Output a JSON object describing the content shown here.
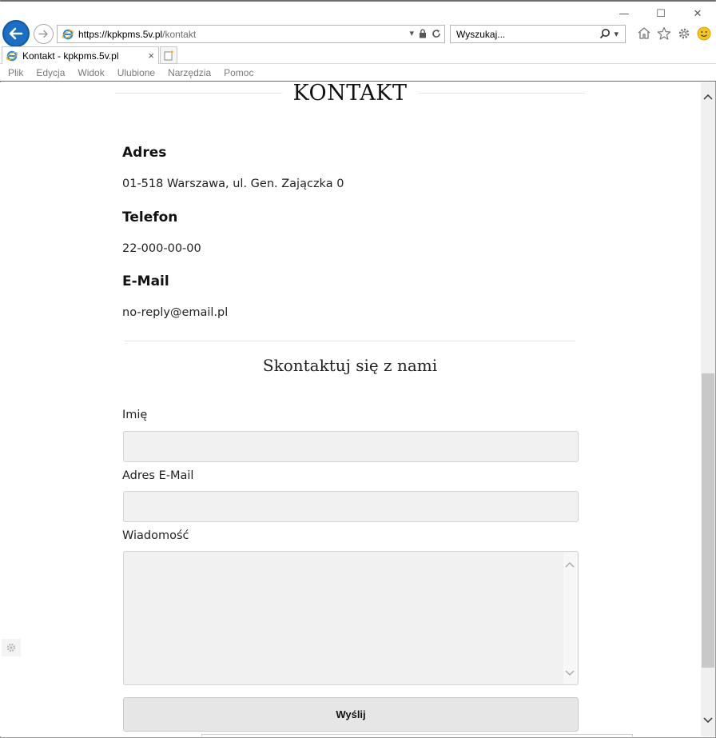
{
  "browser": {
    "window_controls": {
      "minimize": "—",
      "maximize": "☐",
      "close": "✕"
    },
    "address": {
      "host": "https://kpkpms.5v.pl",
      "path": "/kontakt"
    },
    "search": {
      "placeholder": "Wyszukaj..."
    },
    "tab": {
      "title": "Kontakt - kpkpms.5v.pl",
      "close": "×"
    },
    "menu": [
      "Plik",
      "Edycja",
      "Widok",
      "Ulubione",
      "Narzędzia",
      "Pomoc"
    ]
  },
  "page": {
    "title": "KONTAKT",
    "address": {
      "heading": "Adres",
      "value": "01-518 Warszawa, ul. Gen. Zajączka 0"
    },
    "phone": {
      "heading": "Telefon",
      "value": "22-000-00-00"
    },
    "email": {
      "heading": "E-Mail",
      "value": "no-reply@email.pl"
    },
    "form": {
      "title": "Skontaktuj się z nami",
      "name_label": "Imię",
      "email_label": "Adres E-Mail",
      "message_label": "Wiadomość",
      "submit_label": "Wyślij"
    }
  },
  "icons": {
    "back": "back-arrow-icon",
    "forward": "forward-arrow-icon",
    "ie": "ie-logo-icon",
    "lock": "lock-icon",
    "refresh": "refresh-icon",
    "search": "search-icon",
    "home": "home-icon",
    "favorites": "star-icon",
    "settings": "gear-icon",
    "smiley": "smiley-icon"
  },
  "colors": {
    "ie_blue": "#1a6fc4",
    "ie_logo": "#2b8de0",
    "smiley": "#f5c518"
  }
}
